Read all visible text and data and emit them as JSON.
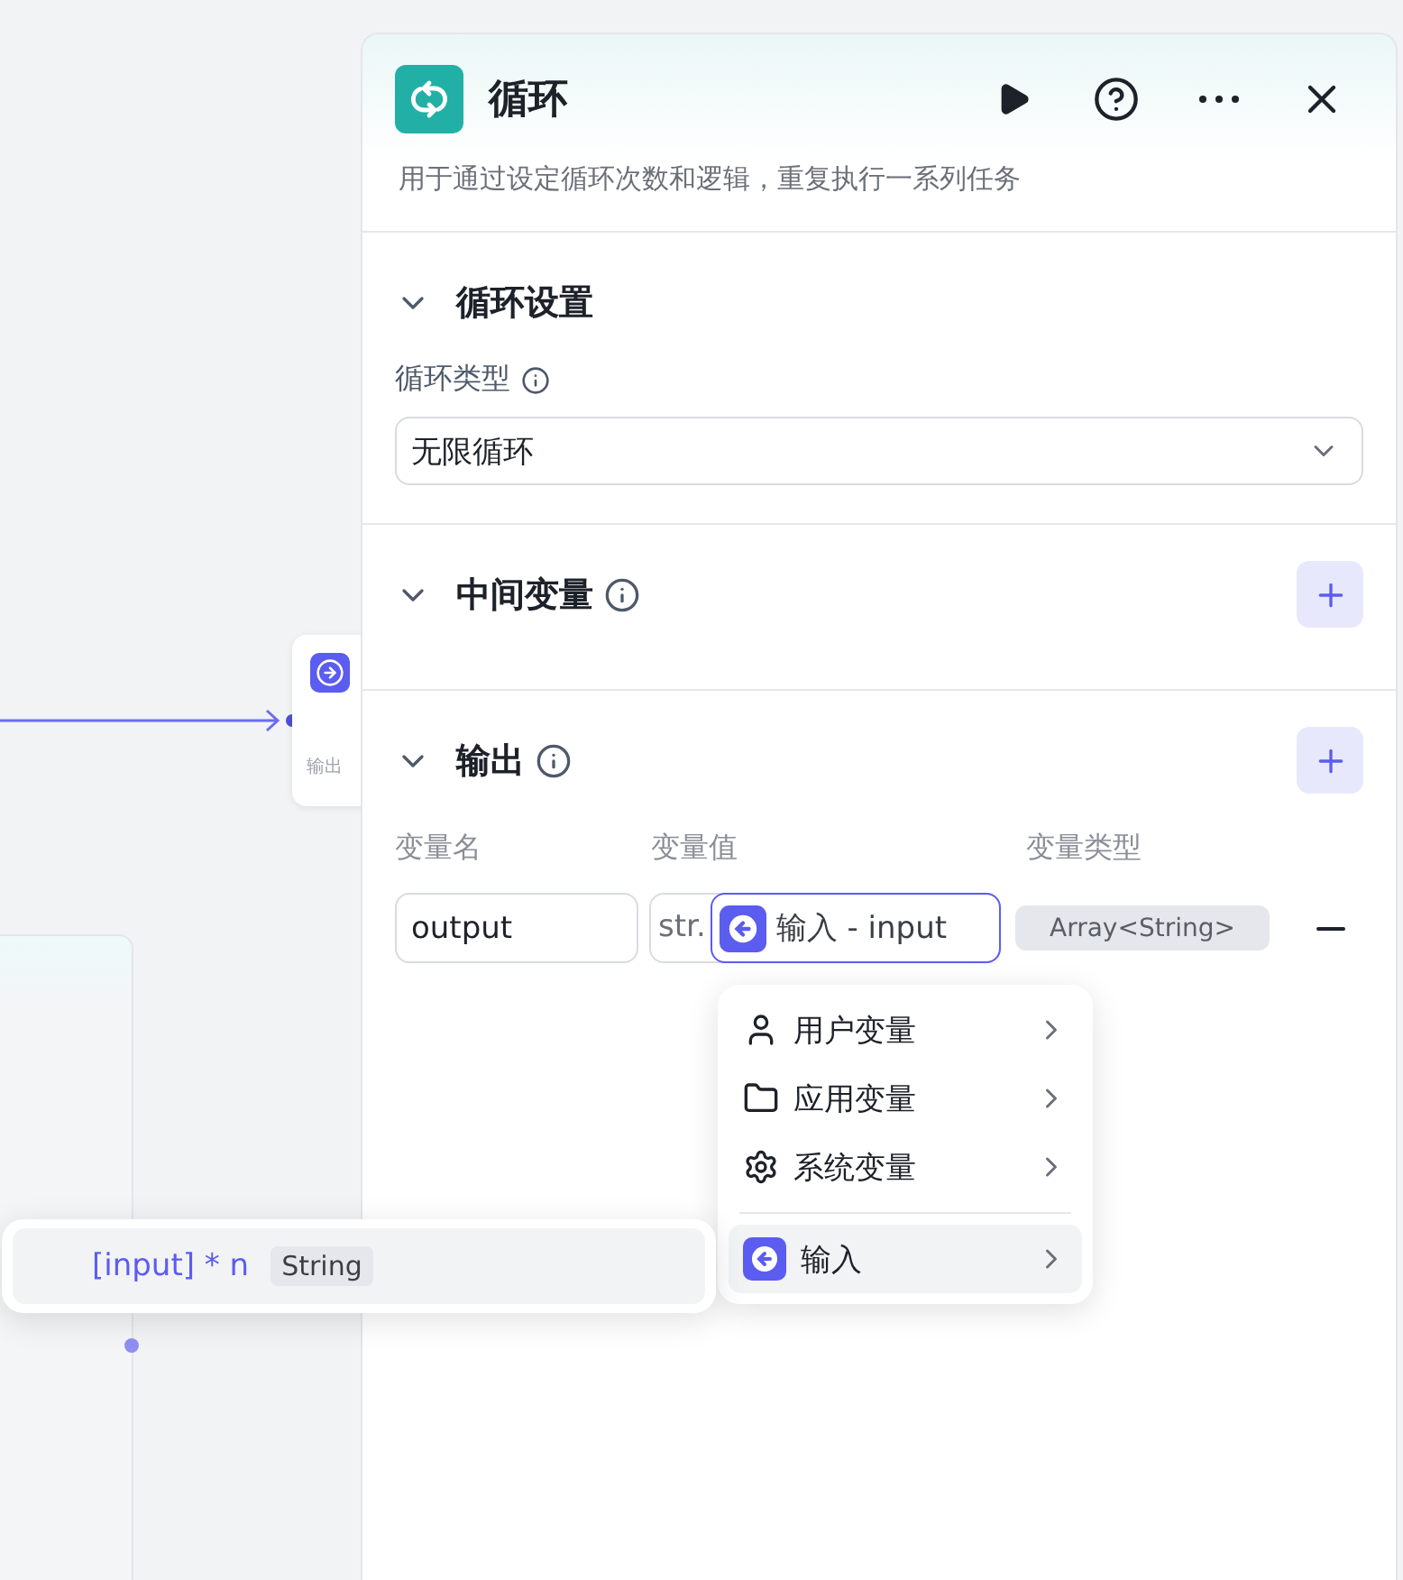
{
  "canvas": {
    "node_text": "输出"
  },
  "panel": {
    "title": "循环",
    "description": "用于通过设定循环次数和逻辑，重复执行一系列任务",
    "sections": [
      {
        "kind": "select",
        "title": "循环设置",
        "expanded": true,
        "info": false,
        "add_button": false,
        "field_label": "循环类型",
        "value": "无限循环"
      },
      {
        "kind": "empty",
        "title": "中间变量",
        "expanded": true,
        "info": true,
        "add_button": true
      },
      {
        "kind": "table",
        "title": "输出",
        "expanded": true,
        "info": true,
        "add_button": true,
        "columns": [
          "变量名",
          "变量值",
          "变量类型"
        ],
        "rows": [
          {
            "name": "output",
            "prefix": "str.",
            "value": "输入 - input",
            "type": "Array<String>"
          }
        ]
      }
    ]
  },
  "menu": {
    "items": [
      {
        "kind": "user",
        "label": "用户变量",
        "selected": false
      },
      {
        "kind": "app",
        "label": "应用变量",
        "selected": false
      },
      {
        "kind": "system",
        "label": "系统变量",
        "selected": false
      },
      {
        "kind": "input",
        "label": "输入",
        "selected": true
      }
    ]
  },
  "submenu": {
    "items": [
      {
        "label": "[input] * n",
        "type": "String",
        "selected": true
      }
    ]
  }
}
